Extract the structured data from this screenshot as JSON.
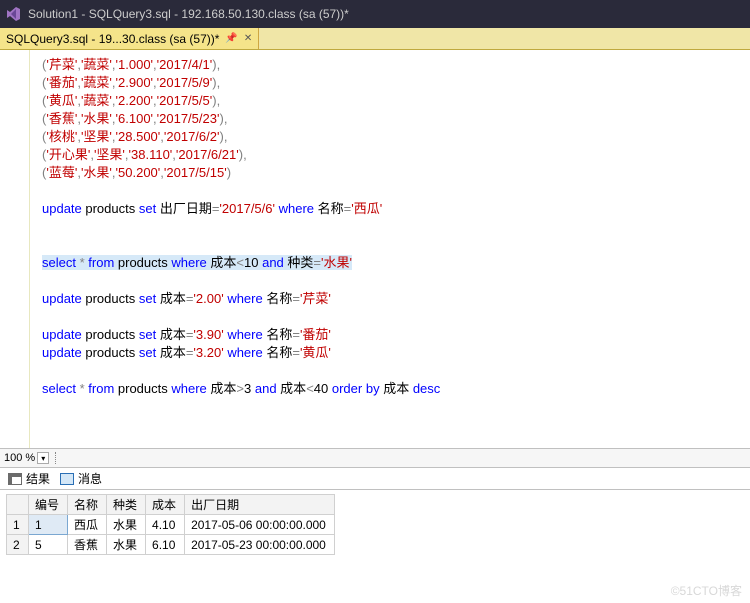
{
  "window": {
    "title": "Solution1 - SQLQuery3.sql - 192.168.50.130.class (sa (57))*"
  },
  "tab": {
    "label": "SQLQuery3.sql - 19...30.class (sa (57))*",
    "pin_glyph": "📌",
    "close_glyph": "✕"
  },
  "code": {
    "rows": [
      [
        "芹菜",
        "蔬菜",
        "1.000",
        "2017/4/1"
      ],
      [
        "番茄",
        "蔬菜",
        "2.900",
        "2017/5/9"
      ],
      [
        "黄瓜",
        "蔬菜",
        "2.200",
        "2017/5/5"
      ],
      [
        "香蕉",
        "水果",
        "6.100",
        "2017/5/23"
      ],
      [
        "核桃",
        "坚果",
        "28.500",
        "2017/6/2"
      ],
      [
        "开心果",
        "坚果",
        "38.110",
        "2017/6/21"
      ],
      [
        "蓝莓",
        "水果",
        "50.200",
        "2017/5/15"
      ]
    ],
    "upd1": {
      "date": "2017/5/6",
      "name": "西瓜",
      "col_date": "出厂日期",
      "col_name": "名称"
    },
    "sel1": {
      "col_cost": "成本",
      "val": "10",
      "col_kind": "种类",
      "kind": "水果"
    },
    "upd2": {
      "cost": "2.00",
      "name": "芹菜"
    },
    "upd3": {
      "cost": "3.90",
      "name": "番茄"
    },
    "upd4": {
      "cost": "3.20",
      "name": "黄瓜"
    },
    "sel2": {
      "col_cost": "成本",
      "lo": "3",
      "hi": "40"
    },
    "kw": {
      "update": "update",
      "set": "set",
      "where": "where",
      "select": "select",
      "from": "from",
      "and": "and",
      "order": "order",
      "by": "by",
      "desc": "desc"
    },
    "ident": {
      "products": "products",
      "star": "*"
    }
  },
  "zoom": {
    "value": "100 %"
  },
  "result_tabs": {
    "results": "结果",
    "messages": "消息"
  },
  "grid": {
    "headers": {
      "id": "编号",
      "name": "名称",
      "kind": "种类",
      "cost": "成本",
      "date": "出厂日期"
    },
    "rows": [
      {
        "n": "1",
        "id": "1",
        "name": "西瓜",
        "kind": "水果",
        "cost": "4.10",
        "date": "2017-05-06 00:00:00.000"
      },
      {
        "n": "2",
        "id": "5",
        "name": "香蕉",
        "kind": "水果",
        "cost": "6.10",
        "date": "2017-05-23 00:00:00.000"
      }
    ]
  },
  "watermark": "©51CTO博客"
}
